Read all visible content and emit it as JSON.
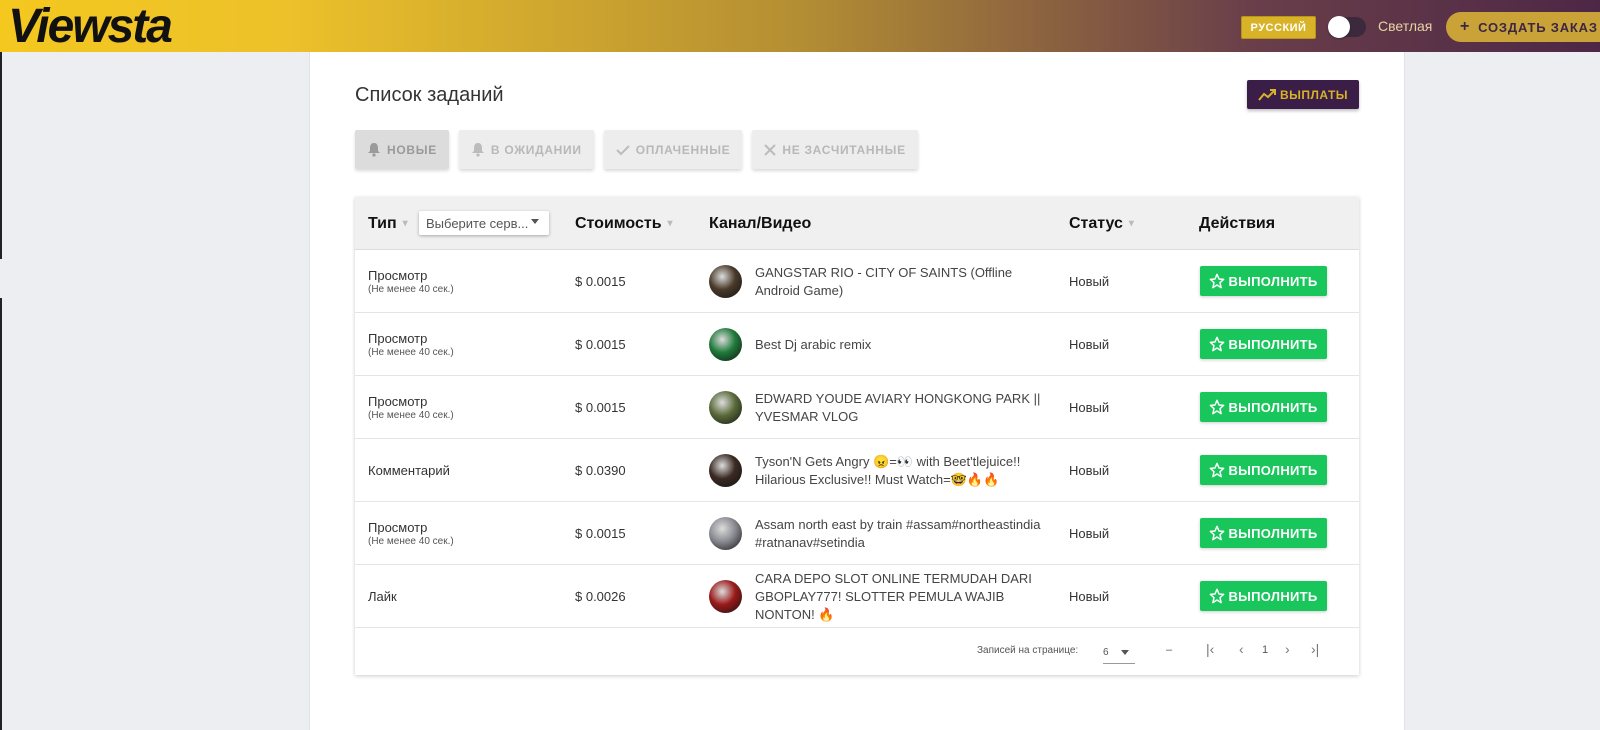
{
  "header": {
    "logo": "Viewsta",
    "language": "РУССКИЙ",
    "theme_label": "Светлая",
    "create_order": "СОЗДАТЬ ЗАКАЗ"
  },
  "page": {
    "title": "Список заданий",
    "payouts_button": "ВЫПЛАТЫ"
  },
  "filters": [
    {
      "label": "НОВЫЕ",
      "icon": "bell-icon"
    },
    {
      "label": "В ОЖИДАНИИ",
      "icon": "bell-icon"
    },
    {
      "label": "ОПЛАЧЕННЫЕ",
      "icon": "check-icon"
    },
    {
      "label": "НЕ ЗАСЧИТАННЫЕ",
      "icon": "close-icon"
    }
  ],
  "table": {
    "headers": {
      "type": "Тип",
      "service_placeholder": "Выберите серв...",
      "cost": "Стоимость",
      "channel": "Канал/Видео",
      "status": "Статус",
      "actions": "Действия"
    },
    "rows": [
      {
        "type": "Просмотр",
        "sub": "(Не менее 40 сек.)",
        "cost": "$ 0.0015",
        "title": "GANGSTAR RIO - CITY OF SAINTS (Offline Android Game)",
        "status": "Новый",
        "action": "ВЫПОЛНИТЬ",
        "avatar_color": "#4a3a2a"
      },
      {
        "type": "Просмотр",
        "sub": "(Не менее 40 сек.)",
        "cost": "$ 0.0015",
        "title": "Best Dj arabic remix",
        "status": "Новый",
        "action": "ВЫПОЛНИТЬ",
        "avatar_color": "#1f7a3a"
      },
      {
        "type": "Просмотр",
        "sub": "(Не менее 40 сек.)",
        "cost": "$ 0.0015",
        "title": "EDWARD YOUDE AVIARY HONGKONG PARK || YVESMAR VLOG",
        "status": "Новый",
        "action": "ВЫПОЛНИТЬ",
        "avatar_color": "#5a6a3a"
      },
      {
        "type": "Комментарий",
        "sub": "",
        "cost": "$ 0.0390",
        "title": "Tyson'N Gets Angry 😠=👀 with Beet'tlejuice!! Hilarious Exclusive!! Must Watch=🤓🔥🔥",
        "status": "Новый",
        "action": "ВЫПОЛНИТЬ",
        "avatar_color": "#3a2a22"
      },
      {
        "type": "Просмотр",
        "sub": "(Не менее 40 сек.)",
        "cost": "$ 0.0015",
        "title": "Assam north east by train #assam#northeastindia #ratnanav#setindia",
        "status": "Новый",
        "action": "ВЫПОЛНИТЬ",
        "avatar_color": "#8a8a92"
      },
      {
        "type": "Лайк",
        "sub": "",
        "cost": "$ 0.0026",
        "title": "CARA DEPO SLOT ONLINE TERMUDAH DARI GBOPLAY777! SLOTTER PEMULA WAJIB NONTON! 🔥",
        "status": "Новый",
        "action": "ВЫПОЛНИТЬ",
        "avatar_color": "#9a1a1a"
      }
    ],
    "footer": {
      "rows_per_page_label": "Записей на странице:",
      "rows_per_page": "6",
      "range": "–",
      "page": "1"
    }
  }
}
